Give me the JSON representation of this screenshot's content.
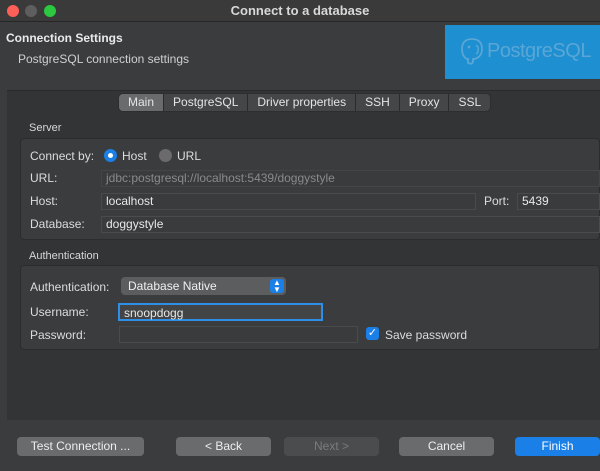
{
  "window": {
    "title": "Connect to a database"
  },
  "header": {
    "title": "Connection Settings",
    "subtitle": "PostgreSQL connection settings",
    "brand": "PostgreSQL",
    "brand_color": "#1e8fd0"
  },
  "tabs": [
    {
      "label": "Main",
      "active": true
    },
    {
      "label": "PostgreSQL",
      "active": false
    },
    {
      "label": "Driver properties",
      "active": false
    },
    {
      "label": "SSH",
      "active": false
    },
    {
      "label": "Proxy",
      "active": false
    },
    {
      "label": "SSL",
      "active": false
    }
  ],
  "server": {
    "section_label": "Server",
    "connect_by_label": "Connect by:",
    "option_host": "Host",
    "option_url": "URL",
    "selected": "Host",
    "url_label": "URL:",
    "url_value": "jdbc:postgresql://localhost:5439/doggystyle",
    "host_label": "Host:",
    "host_value": "localhost",
    "port_label": "Port:",
    "port_value": "5439",
    "database_label": "Database:",
    "database_value": "doggystyle"
  },
  "auth": {
    "section_label": "Authentication",
    "auth_label": "Authentication:",
    "auth_value": "Database Native",
    "username_label": "Username:",
    "username_value": "snoopdogg",
    "password_label": "Password:",
    "password_value": "",
    "save_password_label": "Save password",
    "save_password_checked": true
  },
  "buttons": {
    "test": "Test Connection ...",
    "back": "< Back",
    "next": "Next >",
    "cancel": "Cancel",
    "finish": "Finish"
  },
  "colors": {
    "accent": "#1a7fe6",
    "focus": "#2d8fe8"
  }
}
